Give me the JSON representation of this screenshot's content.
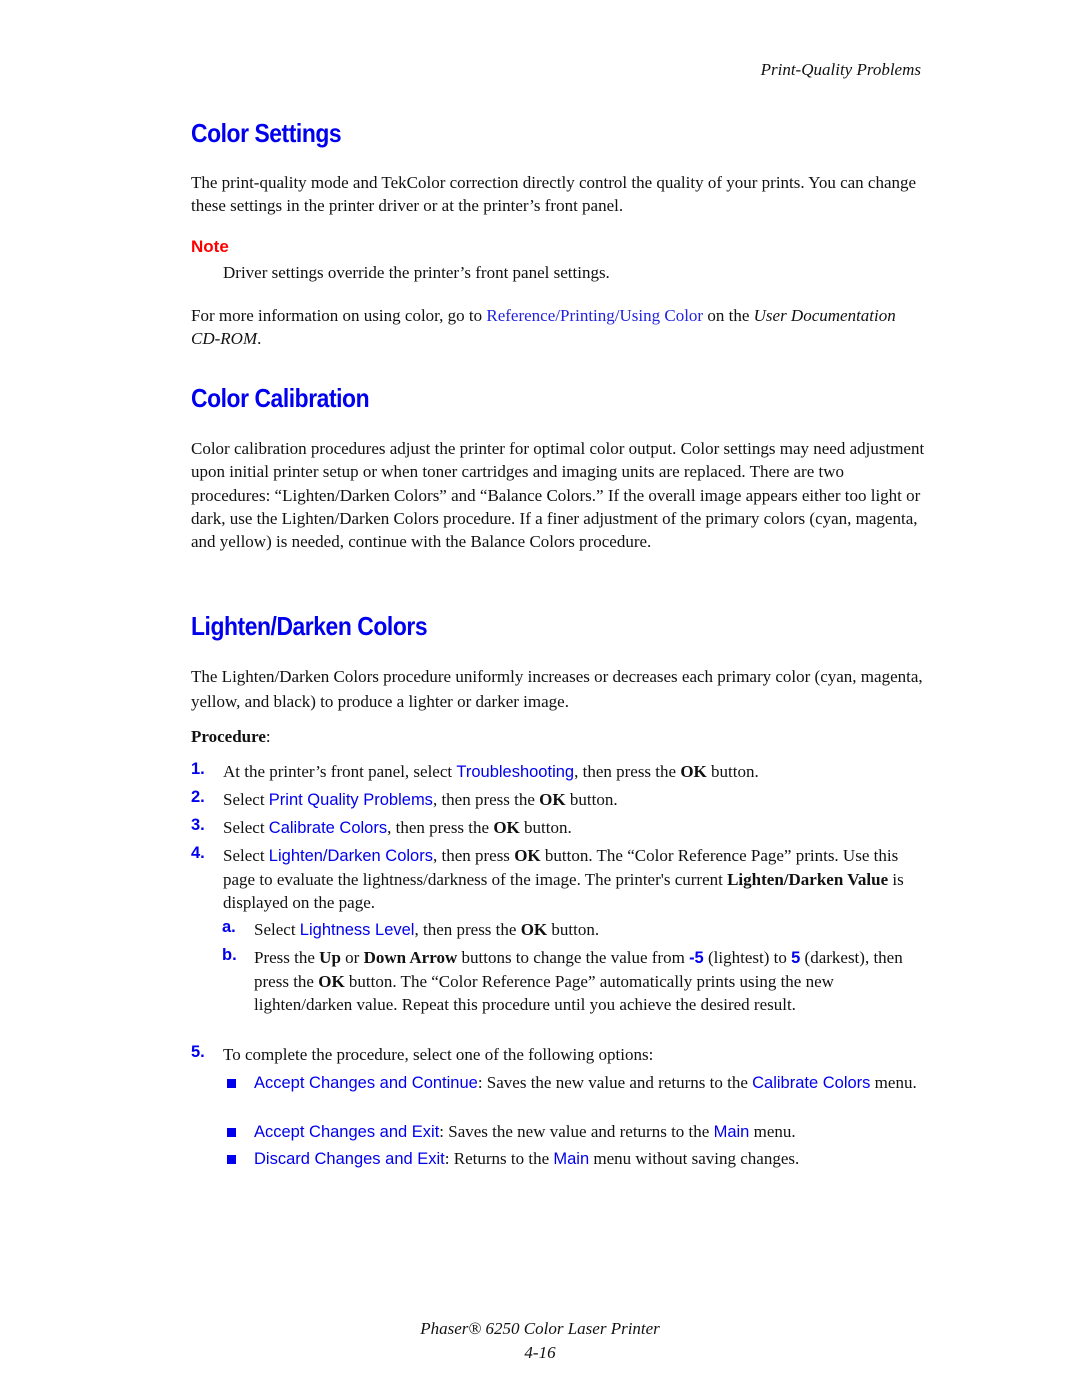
{
  "header": {
    "running_title": "Print-Quality Problems"
  },
  "section_color_settings": {
    "heading": "Color Settings",
    "intro": "The print-quality mode and TekColor correction directly control the quality of your prints. You can change these settings in the printer driver or at the printer’s front panel.",
    "note_label": "Note",
    "note_text": "Driver settings override the printer’s front panel settings.",
    "more_info_prefix": "For more information on using color, go to ",
    "more_info_link": "Reference/Printing/Using Color",
    "more_info_mid": " on the ",
    "more_info_italic": "User Documentation CD-ROM",
    "more_info_suffix": "."
  },
  "section_color_calibration": {
    "heading": "Color Calibration",
    "body": "Color calibration procedures adjust the printer for optimal color output. Color settings may need adjustment upon initial printer setup or when toner cartridges and imaging units are replaced. There are two procedures: “Lighten/Darken Colors” and “Balance Colors.” If the overall image appears either too light or dark, use the Lighten/Darken Colors procedure. If a finer adjustment of the primary colors (cyan, magenta, and yellow) is needed, continue with the Balance Colors procedure."
  },
  "section_lighten_darken": {
    "heading": "Lighten/Darken Colors",
    "body": "The Lighten/Darken Colors procedure uniformly increases or decreases each primary color (cyan, magenta, yellow, and black) to produce a lighter or darker image.",
    "procedure_label": "Procedure",
    "procedure_colon": ":",
    "steps": [
      {
        "num": "1.",
        "pre": "At the printer’s front panel, select ",
        "ui": "Troubleshooting",
        "mid": ", then press the ",
        "bold": "OK",
        "post": " button."
      },
      {
        "num": "2.",
        "pre": "Select ",
        "ui": "Print Quality Problems",
        "mid": ", then press the ",
        "bold": "OK",
        "post": " button."
      },
      {
        "num": "3.",
        "pre": "Select ",
        "ui": "Calibrate Colors",
        "mid": ", then press the ",
        "bold": "OK",
        "post": " button."
      },
      {
        "num": "4.",
        "pre": "Select ",
        "ui": "Lighten/Darken Colors",
        "mid": ", then press ",
        "bold": "OK",
        "post": " button. The “Color Reference Page” prints. Use this page to evaluate the lightness/darkness of the image. The printer's current ",
        "bold2": "Lighten/Darken Value",
        "post2": " is displayed on the page."
      },
      {
        "num": "5.",
        "text": "To complete the procedure, select one of the following options:"
      }
    ],
    "substeps": [
      {
        "num": "a.",
        "pre": "Select ",
        "ui": "Lightness Level",
        "mid": ", then press the ",
        "bold": "OK",
        "post": " button."
      },
      {
        "num": "b.",
        "pre": "Press the ",
        "bold_up": "Up",
        "or": " or ",
        "bold_down": "Down Arrow",
        "mid": " buttons to change the value from ",
        "val_min": "-5",
        "mid2": " (lightest) to ",
        "val_max": "5",
        "post": " (darkest), then press the ",
        "bold": "OK",
        "post2": " button. The “Color Reference Page” automatically prints using the new lighten/darken value. Repeat this procedure until you achieve the desired result."
      }
    ],
    "options": [
      {
        "ui": "Accept Changes and Continue",
        "text": ": Saves the new value and returns to the ",
        "ui2": "Calibrate Colors",
        "post": " menu."
      },
      {
        "ui": "Accept Changes and Exit",
        "text": ": Saves the new value and returns to the ",
        "ui2": "Main",
        "post": " menu."
      },
      {
        "ui": "Discard Changes and Exit",
        "text": ": Returns to the ",
        "ui2": "Main",
        "post": " menu without saving changes."
      }
    ]
  },
  "footer": {
    "product": "Phaser® 6250 Color Laser Printer",
    "page_number": "4-16"
  },
  "colors": {
    "heading_blue": "#0000ee",
    "note_red": "#ff0000",
    "link_blue": "#2222dd"
  }
}
